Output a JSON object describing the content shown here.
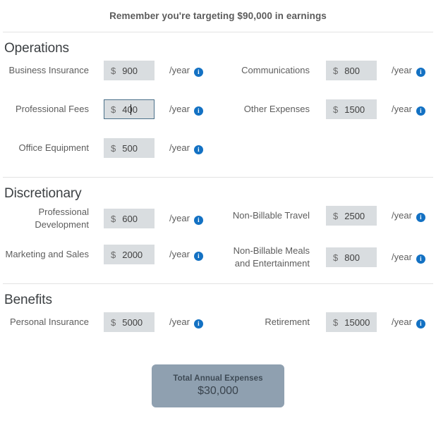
{
  "banner": {
    "text": "Remember you're targeting $90,000 in earnings"
  },
  "common": {
    "currency_symbol": "$",
    "per_year_label": "/year",
    "info_icon_glyph": "i",
    "info_icon_name": "info-circle-icon"
  },
  "colors": {
    "input_background": "#d9dde0",
    "input_focus_border": "#4a7089",
    "info_icon": "#1371c3",
    "total_box_background": "#8fa0b0",
    "divider": "#e3e3e3",
    "heading_text": "#3c4043",
    "label_text": "#5d5d5d"
  },
  "sections": [
    {
      "title": "Operations",
      "rows": [
        {
          "left": {
            "label": "Business Insurance",
            "value": "900",
            "focused": false
          },
          "right": {
            "label": "Communications",
            "value": "800",
            "focused": false
          }
        },
        {
          "left": {
            "label": "Professional Fees",
            "value": "400",
            "focused": true
          },
          "right": {
            "label": "Other Expenses",
            "value": "1500",
            "focused": false
          }
        },
        {
          "left": {
            "label": "Office Equipment",
            "value": "500",
            "focused": false
          },
          "right": null
        }
      ]
    },
    {
      "title": "Discretionary",
      "rows": [
        {
          "left": {
            "label": "Professional Development",
            "value": "600",
            "focused": false
          },
          "right": {
            "label": "Non-Billable Travel",
            "value": "2500",
            "focused": false
          }
        },
        {
          "left": {
            "label": "Marketing and Sales",
            "value": "2000",
            "focused": false
          },
          "right": {
            "label": "Non-Billable Meals and Entertainment",
            "value": "800",
            "focused": false
          }
        }
      ]
    },
    {
      "title": "Benefits",
      "rows": [
        {
          "left": {
            "label": "Personal Insurance",
            "value": "5000",
            "focused": false
          },
          "right": {
            "label": "Retirement",
            "value": "15000",
            "focused": false
          }
        }
      ]
    }
  ],
  "total": {
    "label": "Total Annual Expenses",
    "value": "$30,000"
  }
}
